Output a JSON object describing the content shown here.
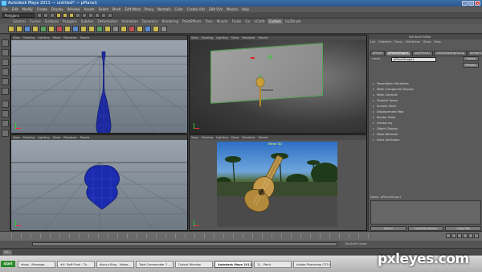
{
  "window": {
    "title": "Autodesk Maya 2011 — untitled* — pPlane1"
  },
  "menubar": [
    "File",
    "Edit",
    "Modify",
    "Create",
    "Display",
    "Window",
    "Assets",
    "Select",
    "Mesh",
    "Edit Mesh",
    "Proxy",
    "Normals",
    "Color",
    "Create UVs",
    "Edit UVs",
    "Muscle",
    "Help"
  ],
  "status": {
    "mode": "Polygons"
  },
  "shelf_tabs": [
    "General",
    "Curves",
    "Surfaces",
    "Polygons",
    "Subdivs",
    "Deformation",
    "Animation",
    "Dynamics",
    "Rendering",
    "PaintEffects",
    "Toon",
    "Muscle",
    "Fluids",
    "Fur",
    "nCloth",
    "Custom",
    "GoZBrush"
  ],
  "shelf_active_tab": 15,
  "viewport_menu": [
    "View",
    "Shading",
    "Lighting",
    "Show",
    "Renderer",
    "Panels"
  ],
  "viewports": {
    "top_right_label": "",
    "bottom_right_label": "Mirror 3D"
  },
  "attribute_editor": {
    "header": "Attribute Editor",
    "menu": [
      "List",
      "Selected",
      "Focus",
      "Attributes",
      "Show",
      "Help"
    ],
    "tabs": [
      "pPlane",
      "pPlaneShape1",
      "polyPlane1",
      "initialShadingGroup",
      "lambert1"
    ],
    "active_tab": 1,
    "name_label": "mesh:",
    "name_value": "pPlaneShape1",
    "focus_label": "Focus",
    "presets_label": "Presets",
    "sections": [
      "Tessellation Attributes",
      "Mesh Component Display",
      "Mesh Controls",
      "Tangent Space",
      "Smooth Mesh",
      "Displacement Map",
      "Render Stats",
      "mental ray",
      "Object Display",
      "Node Behavior",
      "Extra Attributes"
    ],
    "notes_label": "Notes: pPlaneShape1",
    "buttons": [
      "Select",
      "Load Attributes",
      "Copy Tab"
    ]
  },
  "rangebar": {
    "layer_label": "No Anim Layer"
  },
  "cmdline": {
    "label": "MEL"
  },
  "taskbar": {
    "start": "start",
    "items": [
      "Inbox - Message...",
      "#4: Daft Punk - Th...",
      "discs.s.Bing - Yahoo...",
      "Total Commander 7 ...",
      "Output Window",
      "Autodesk Maya 2011...",
      "11 - Paint",
      "Adobe Photoshop CS3 E..."
    ],
    "active_index": 5
  },
  "watermark": "pxleyes.com"
}
